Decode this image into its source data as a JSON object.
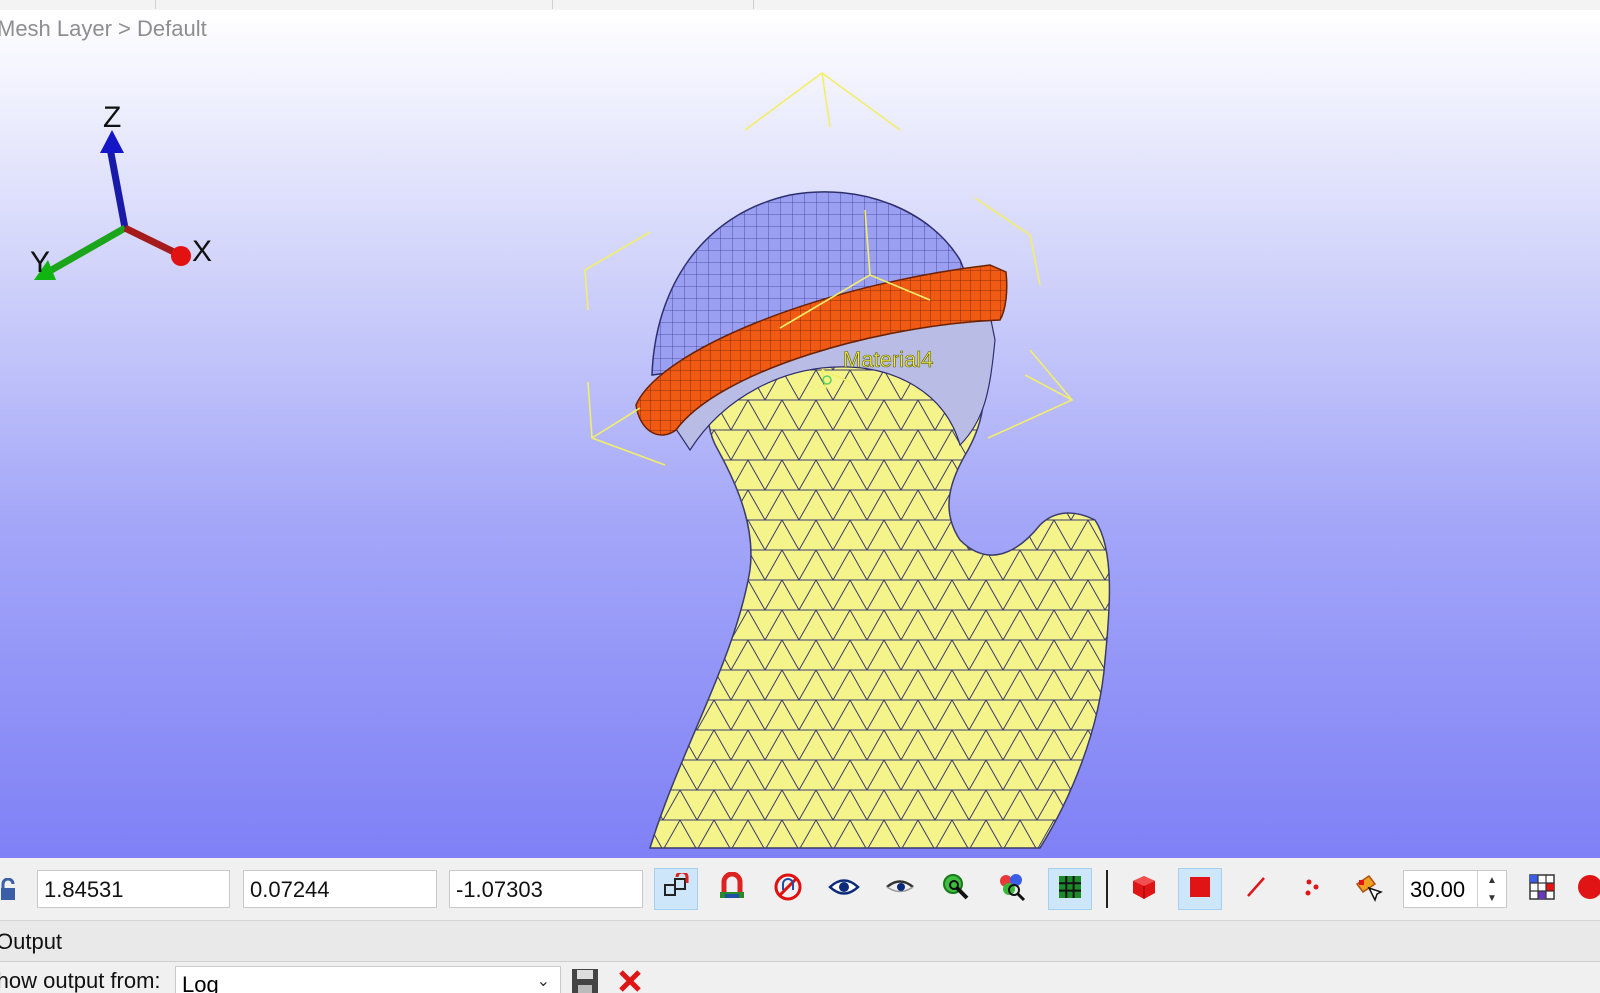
{
  "viewport": {
    "breadcrumb": "Mesh Layer > Default",
    "axes": {
      "z": "Z",
      "y": "Y",
      "x": "X"
    },
    "object_label": "Material4",
    "colors": {
      "background_top": "#ffffff",
      "background_bottom": "#7f80f6",
      "mesh_body": "#f5f48a",
      "mesh_cap": "#9a9ff2",
      "mesh_ring": "#f05a12",
      "wire": "#3b3b6e",
      "bounding_box": "#f2ee6a"
    }
  },
  "toolbar": {
    "coord_x": "1.84531",
    "coord_y": "0.07244",
    "coord_z": "-1.07303",
    "angle_value": "30.00",
    "buttons": [
      {
        "icon": "snap-grid-icon",
        "active": true
      },
      {
        "icon": "magnet-icon",
        "active": false
      },
      {
        "icon": "no-snap-icon",
        "active": false
      },
      {
        "icon": "eye-icon",
        "active": false
      },
      {
        "icon": "eye-half-icon",
        "active": false
      },
      {
        "icon": "zoom-icon",
        "active": false
      },
      {
        "icon": "zoom-objects-icon",
        "active": false
      },
      {
        "icon": "grid-icon",
        "active": true
      },
      {
        "icon": "solid-cube-icon",
        "active": false
      },
      {
        "icon": "face-select-icon",
        "active": true
      },
      {
        "icon": "edge-select-icon",
        "active": false
      },
      {
        "icon": "vertex-select-icon",
        "active": false
      },
      {
        "icon": "paint-select-icon",
        "active": false
      }
    ]
  },
  "output": {
    "title": "Output",
    "show_label": "Show output from:",
    "selected": "Log"
  }
}
